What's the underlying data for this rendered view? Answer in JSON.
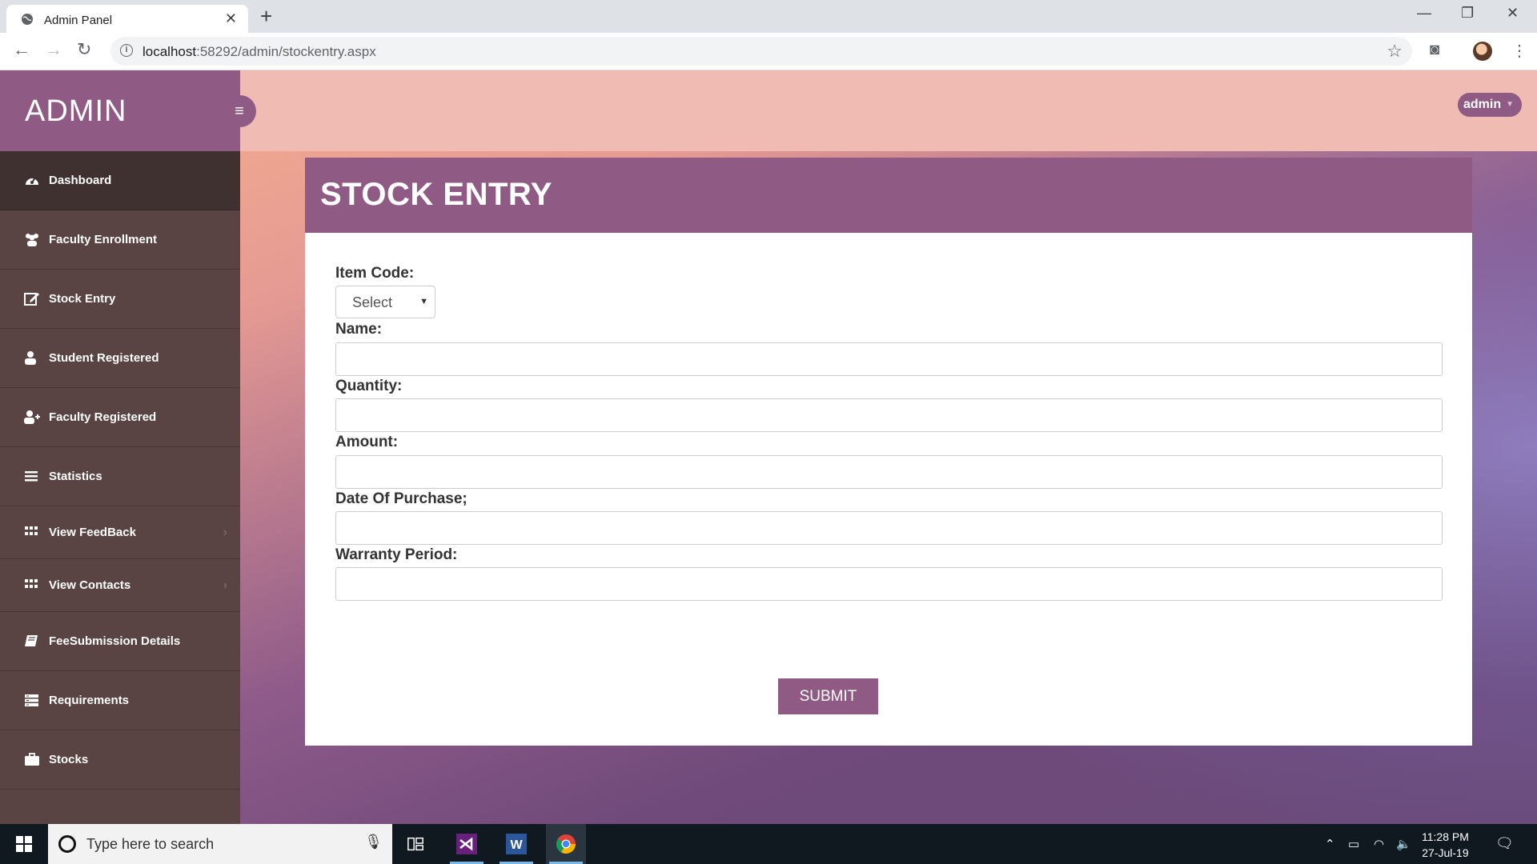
{
  "browser": {
    "tab_title": "Admin Panel",
    "url_host": "localhost",
    "url_path": ":58292/admin/stockentry.aspx",
    "new_tab_glyph": "+"
  },
  "sidebar": {
    "brand": "ADMIN",
    "items": [
      {
        "label": "Dashboard",
        "icon": "dashboard-icon"
      },
      {
        "label": "Faculty Enrollment",
        "icon": "users-icon"
      },
      {
        "label": "Stock Entry",
        "icon": "edit-icon"
      },
      {
        "label": "Student Registered",
        "icon": "user-icon"
      },
      {
        "label": "Faculty Registered",
        "icon": "user-plus-icon"
      },
      {
        "label": "Statistics",
        "icon": "bars-icon"
      },
      {
        "label": "View FeedBack",
        "icon": "grid-icon"
      },
      {
        "label": "View Contacts",
        "icon": "grid-icon"
      },
      {
        "label": "FeeSubmission Details",
        "icon": "book-icon"
      },
      {
        "label": "Requirements",
        "icon": "list-icon"
      },
      {
        "label": "Stocks",
        "icon": "briefcase-icon"
      }
    ]
  },
  "header": {
    "user_label": "admin"
  },
  "form": {
    "title": "STOCK ENTRY",
    "item_code_label": "Item Code:",
    "item_code_value": "Select",
    "name_label": "Name:",
    "quantity_label": "Quantity:",
    "amount_label": "Amount:",
    "date_label": "Date Of Purchase;",
    "warranty_label": "Warranty Period:",
    "submit_label": "SUBMIT"
  },
  "taskbar": {
    "search_placeholder": "Type here to search",
    "time": "11:28 PM",
    "date": "27-Jul-19"
  },
  "colors": {
    "accent": "#8f5b84",
    "sidebar": "#594443",
    "header": "#f0bbb3"
  }
}
